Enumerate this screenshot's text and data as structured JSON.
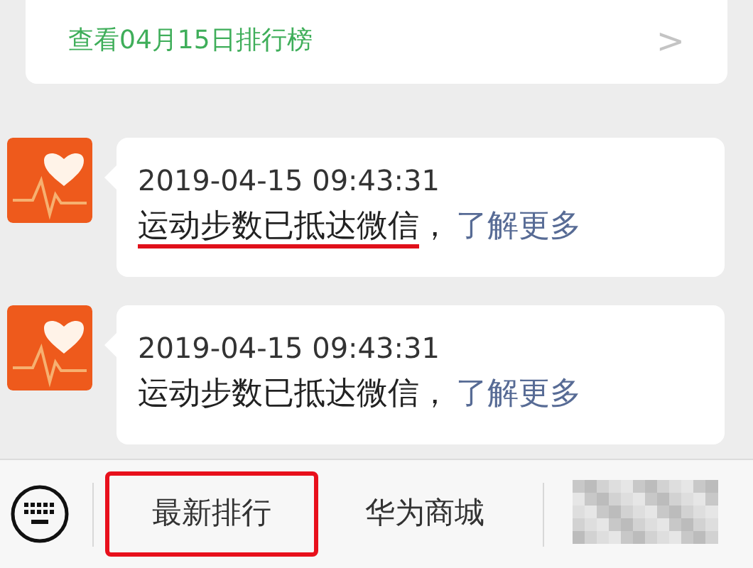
{
  "ranking_card": {
    "label": "查看04月15日排行榜",
    "chevron": ">"
  },
  "messages": [
    {
      "time": "2019-04-15 09:43:31",
      "text": "运动步数已抵达微信",
      "separator": "，",
      "link": "了解更多",
      "underlined": true
    },
    {
      "time": "2019-04-15 09:43:31",
      "text": "运动步数已抵达微信",
      "separator": "，",
      "link": "了解更多",
      "underlined": false
    }
  ],
  "menu": [
    {
      "kind": "text",
      "label": "最新排行",
      "highlighted": true
    },
    {
      "kind": "text",
      "label": "华为商城",
      "highlighted": false
    },
    {
      "kind": "blurred"
    }
  ]
}
